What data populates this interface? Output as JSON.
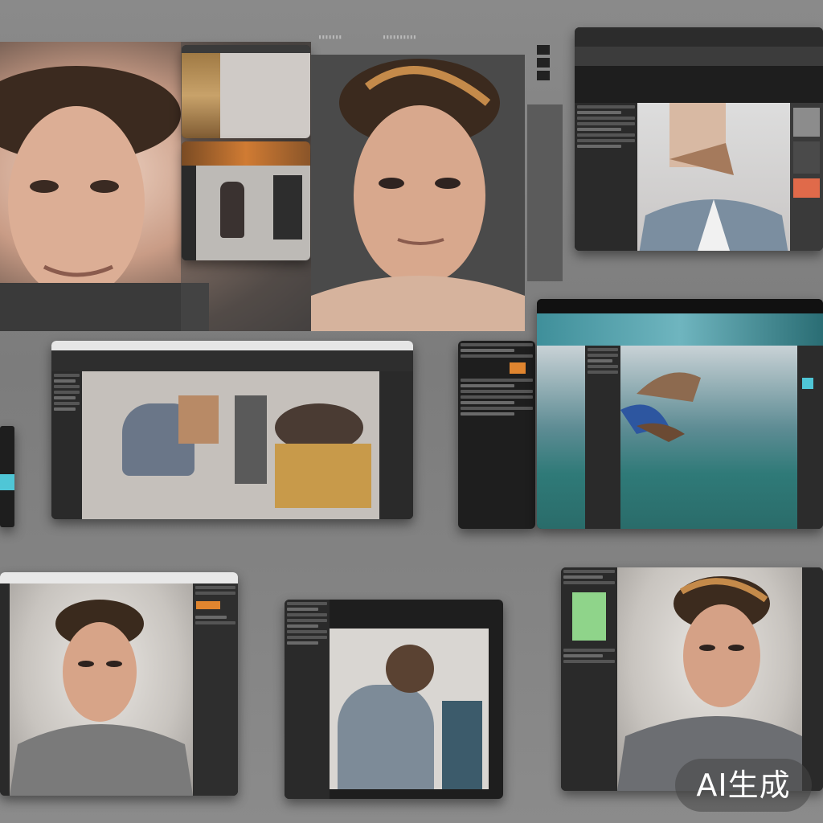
{
  "badge": {
    "text": "AI生成"
  },
  "colors": {
    "background": "#828282",
    "device_frame": "#1e1e1e",
    "panel": "#2a2a2a",
    "accent_orange": "#e0852f",
    "accent_cyan": "#4fc6d6",
    "accent_green": "#8fd48a"
  },
  "icons": [
    "face-portrait",
    "hair",
    "software-panel",
    "thumbnail-strip"
  ]
}
